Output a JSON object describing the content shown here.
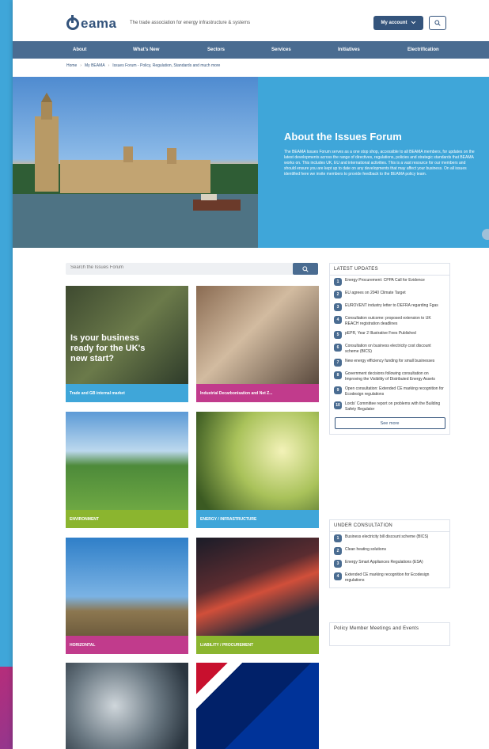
{
  "header": {
    "logo": "eama",
    "tagline": "The trade association for energy infrastructure & systems",
    "account_label": "My account"
  },
  "nav": {
    "items": [
      "About",
      "What's New",
      "Sectors",
      "Services",
      "Initiatives",
      "Electrification"
    ]
  },
  "breadcrumb": [
    "Home",
    "My BEAMA",
    "Issues Forum - Policy, Regulation, Standards and much more"
  ],
  "hero": {
    "title": "About the Issues Forum",
    "body": "The BEAMA Issues Forum serves as a one stop shop, accessible to all BEAMA members, for updates on the latest developments across the range of directives, regulations, policies and strategic standards that BEAMA works on. This includes UK, EU and international activities. This is a vast resource for our members and should ensure you are kept up to date on any developments that may affect your business. On all issues identified here we invite members to provide feedback to the BEAMA policy team."
  },
  "search": {
    "placeholder": "Search the Issues Forum"
  },
  "tiles": [
    {
      "label": "Trade and GB internal market",
      "overlay": "Is your business ready for the UK's new start?",
      "color": "#3fa6d9"
    },
    {
      "label": "Industrial Decarbonisation and Net Z...",
      "color": "#c13b8c"
    },
    {
      "label": "ENVIRONMENT",
      "color": "#8bb52f"
    },
    {
      "label": "ENERGY / INFRASTRUCTURE",
      "color": "#3fa6d9"
    },
    {
      "label": "HORIZONTAL",
      "color": "#c13b8c"
    },
    {
      "label": "LIABILITY / PROCUREMENT",
      "color": "#8bb52f"
    }
  ],
  "latest_updates": {
    "title": "LATEST UPDATES",
    "items": [
      {
        "n": "1",
        "text": "Energy Procurement: CPPA Call for Evidence"
      },
      {
        "n": "2",
        "text": "EU agrees on 2040 Climate Target"
      },
      {
        "n": "3",
        "text": "EUROVENT industry letter to DEFRA regarding Fgas"
      },
      {
        "n": "4",
        "text": "Consultation outcome: proposed extension to UK REACH registration deadlines"
      },
      {
        "n": "5",
        "text": "pEPR, Year 2 Illustrative Fees Published"
      },
      {
        "n": "6",
        "text": "Consultation on business electricity cost discount scheme (BICS)"
      },
      {
        "n": "7",
        "text": "New energy efficiency funding for small businesses"
      },
      {
        "n": "8",
        "text": "Government decisions following consultation on Improving the Visibility of Distributed Energy Assets"
      },
      {
        "n": "9",
        "text": "Open consultation: Extended CE marking recognition for Ecodesign regulations"
      },
      {
        "n": "10",
        "text": "Lords' Committee report on problems with the Building Safety Regulator"
      }
    ],
    "see_more": "See more"
  },
  "under_consultation": {
    "title": "UNDER CONSULTATION",
    "items": [
      {
        "n": "1",
        "text": "Business electricity bill discount scheme (BICS)"
      },
      {
        "n": "2",
        "text": "Clean heating solutions"
      },
      {
        "n": "3",
        "text": "Energy Smart Appliances Regulations (ESA)"
      },
      {
        "n": "4",
        "text": "Extended CE marking recognition for Ecodesign regulations"
      }
    ]
  },
  "events": {
    "title": "Policy Member Meetings and Events"
  }
}
